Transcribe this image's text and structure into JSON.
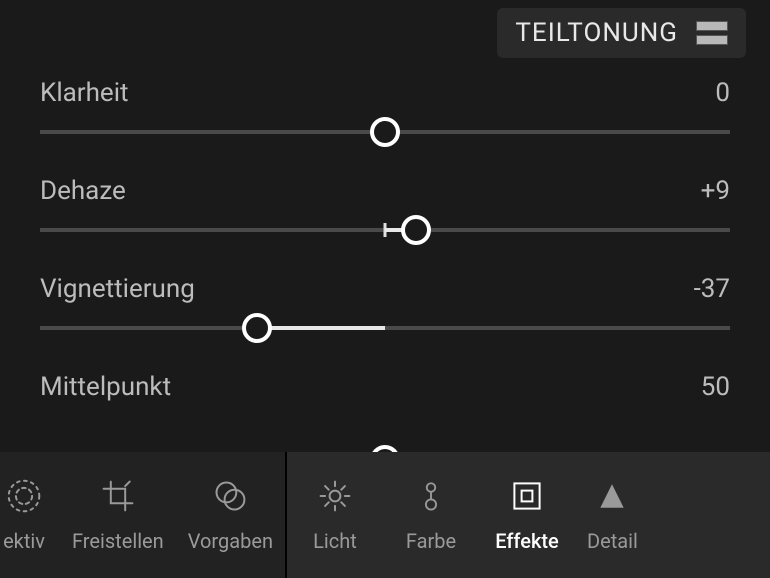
{
  "header": {
    "split_toning_label": "TEILTONUNG"
  },
  "sliders": [
    {
      "label": "Klarheit",
      "value": "0",
      "min": -100,
      "max": 100,
      "num": 0,
      "bipolar": true
    },
    {
      "label": "Dehaze",
      "value": "+9",
      "min": -100,
      "max": 100,
      "num": 9,
      "bipolar": true,
      "showTick": true
    },
    {
      "label": "Vignettierung",
      "value": "-37",
      "min": -100,
      "max": 100,
      "num": -37,
      "bipolar": true
    },
    {
      "label": "Mittelpunkt",
      "value": "50",
      "min": 0,
      "max": 100,
      "num": 50,
      "bipolar": false,
      "partial": true
    }
  ],
  "toolbar": {
    "left": [
      {
        "id": "selektiv",
        "label": "ektiv",
        "icon": "radial-icon"
      },
      {
        "id": "freistellen",
        "label": "Freistellen",
        "icon": "crop-icon"
      },
      {
        "id": "vorgaben",
        "label": "Vorgaben",
        "icon": "presets-icon"
      }
    ],
    "right": [
      {
        "id": "licht",
        "label": "Licht",
        "icon": "light-icon",
        "active": false
      },
      {
        "id": "farbe",
        "label": "Farbe",
        "icon": "color-icon",
        "active": false
      },
      {
        "id": "effekte",
        "label": "Effekte",
        "icon": "effects-icon",
        "active": true
      },
      {
        "id": "detail",
        "label": "Detail",
        "icon": "detail-icon",
        "active": false
      }
    ]
  }
}
